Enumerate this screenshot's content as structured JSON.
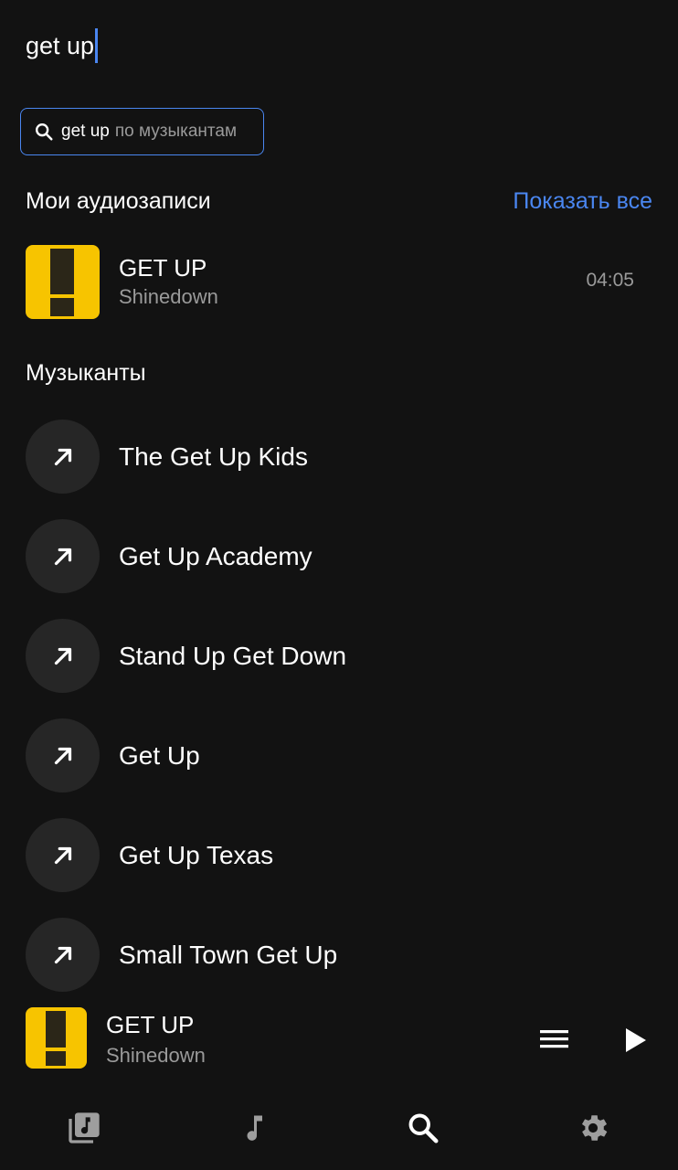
{
  "search": {
    "query": "get up"
  },
  "chip": {
    "query": "get up",
    "scope": "по музыкантам"
  },
  "my_audio": {
    "title": "Мои аудиозаписи",
    "show_all": "Показать все",
    "tracks": [
      {
        "title": "GET UP",
        "artist": "Shinedown",
        "duration": "04:05"
      }
    ]
  },
  "artists": {
    "title": "Музыканты",
    "items": [
      {
        "name": "The Get Up Kids"
      },
      {
        "name": "Get Up Academy"
      },
      {
        "name": "Stand Up Get Down"
      },
      {
        "name": "Get Up"
      },
      {
        "name": "Get Up Texas"
      },
      {
        "name": "Small Town Get Up"
      }
    ]
  },
  "player": {
    "title": "GET UP",
    "artist": "Shinedown"
  },
  "nav": {
    "items": [
      {
        "icon": "library-icon"
      },
      {
        "icon": "music-note-icon"
      },
      {
        "icon": "search-icon",
        "active": true
      },
      {
        "icon": "settings-gear-icon"
      }
    ]
  },
  "colors": {
    "accent": "#4a86f0",
    "background": "#121212",
    "cover": "#f7c400"
  }
}
